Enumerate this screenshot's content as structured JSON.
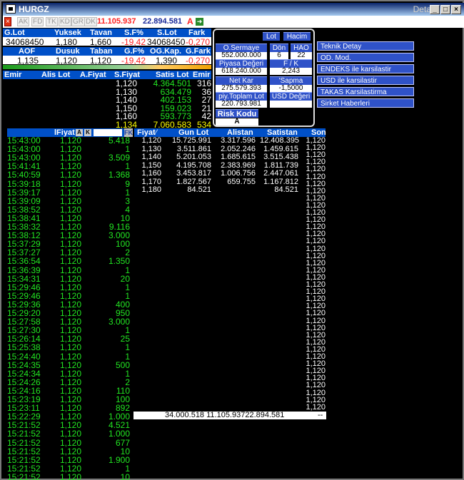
{
  "window": {
    "title": "HURGZ",
    "detail": "Detay",
    "min_icon": "minimize-icon",
    "max_icon": "maximize-icon",
    "close_icon": "close-icon"
  },
  "toolbar": {
    "buttons": [
      "AK",
      "FD",
      "TK",
      "KD",
      "GR",
      "DK"
    ],
    "value1": "11.105.937",
    "value2": "22.894.581",
    "a_label": "A"
  },
  "header1": {
    "labels": [
      "G.Lot",
      "Yuksek",
      "Tavan",
      "S.F%",
      "S.Lot",
      "Fark"
    ],
    "values": [
      "34068450",
      "1,180",
      "1,660",
      "-19,42",
      "34068450",
      "-0,270"
    ]
  },
  "header2": {
    "labels": [
      "AOF",
      "Dusuk",
      "Taban",
      "G.F%",
      "OG.Kap.",
      "G.Fark"
    ],
    "values": [
      "1,135",
      "1,120",
      "1,120",
      "-19,42",
      "1,390",
      "-0,270"
    ]
  },
  "panel": {
    "lot": "Lot",
    "hacim": "Hacim",
    "osermaye_label": "O.Sermaye",
    "osermaye": "552.000.000",
    "don_label": "Dön",
    "don": "6",
    "hao_label": "HAO",
    "hao": "22",
    "piyasa_label": "Piyasa Değeri",
    "piyasa": "618.240.000",
    "fk_label": "F / K",
    "fk": "2,243",
    "netkar_label": "Net Kar",
    "netkar": "275.579.393",
    "sapma_label": "'Sapma",
    "sapma": "-1,5000",
    "piy_label": "piy.Toplam Lot",
    "piy": "220.793.981",
    "usd_label": "USD Değeri",
    "usd": "",
    "risk_label": "Risk Kodu",
    "risk": "A"
  },
  "side_buttons": [
    "Teknik Detay",
    "OD. Mod.",
    "ENDEKS ile karsilastir",
    "USD ile karsilastir",
    "TAKAS Karsilastirma",
    "Sirket Haberleri"
  ],
  "depth": {
    "headers": [
      "Emir",
      "Alis Lot",
      "A.Fiyat",
      "S.Fiyat",
      "Satis Lot",
      "Emir"
    ],
    "rows": [
      [
        "1,120",
        "4.364.501",
        "316"
      ],
      [
        "1,130",
        "634.479",
        "36"
      ],
      [
        "1,140",
        "402.153",
        "27"
      ],
      [
        "1,150",
        "159.023",
        "21"
      ],
      [
        "1,160",
        "593.773",
        "42"
      ],
      [
        "1,134",
        "7.060.583",
        "534"
      ]
    ]
  },
  "trades": {
    "headers": [
      "lFiyat",
      "A",
      "K",
      "FK"
    ],
    "rows": [
      [
        "15:43:00",
        "1,120",
        "5.418"
      ],
      [
        "15:43:00",
        "1,120",
        "1"
      ],
      [
        "15:43:00",
        "1,120",
        "3.509"
      ],
      [
        "15:41:41",
        "1,120",
        "1"
      ],
      [
        "15:40:59",
        "1,120",
        "1.368"
      ],
      [
        "15:39:18",
        "1,120",
        "9"
      ],
      [
        "15:39:17",
        "1,120",
        "1"
      ],
      [
        "15:39:09",
        "1,120",
        "3"
      ],
      [
        "15:38:52",
        "1,120",
        "4"
      ],
      [
        "15:38:41",
        "1,120",
        "10"
      ],
      [
        "15:38:32",
        "1,120",
        "9.116"
      ],
      [
        "15:38:12",
        "1,120",
        "3.000"
      ],
      [
        "15:37:29",
        "1,120",
        "100"
      ],
      [
        "15:37:27",
        "1,120",
        "2"
      ],
      [
        "15:36:54",
        "1,120",
        "1.350"
      ],
      [
        "15:36:39",
        "1,120",
        "1"
      ],
      [
        "15:34:31",
        "1,120",
        "20"
      ],
      [
        "15:29:46",
        "1,120",
        "1"
      ],
      [
        "15:29:46",
        "1,120",
        "1"
      ],
      [
        "15:29:36",
        "1,120",
        "400"
      ],
      [
        "15:29:20",
        "1,120",
        "950"
      ],
      [
        "15:27:58",
        "1,120",
        "3.000"
      ],
      [
        "15:27:30",
        "1,120",
        "1"
      ],
      [
        "15:26:14",
        "1,120",
        "25"
      ],
      [
        "15:25:38",
        "1,120",
        "1"
      ],
      [
        "15:24:40",
        "1,120",
        "1"
      ],
      [
        "15:24:35",
        "1,120",
        "500"
      ],
      [
        "15:24:34",
        "1,120",
        "1"
      ],
      [
        "15:24:26",
        "1,120",
        "2"
      ],
      [
        "15:24:16",
        "1,120",
        "110"
      ],
      [
        "15:23:19",
        "1,120",
        "100"
      ],
      [
        "15:23:11",
        "1,120",
        "892"
      ],
      [
        "15:22:29",
        "1,120",
        "1.000"
      ],
      [
        "15:21:52",
        "1,120",
        "4.521"
      ],
      [
        "15:21:52",
        "1,120",
        "1.000"
      ],
      [
        "15:21:52",
        "1,120",
        "677"
      ],
      [
        "15:21:52",
        "1,120",
        "10"
      ],
      [
        "15:21:52",
        "1,120",
        "1.900"
      ],
      [
        "15:21:52",
        "1,120",
        "1"
      ],
      [
        "15:21:52",
        "1,120",
        "10"
      ]
    ]
  },
  "orderbook": {
    "headers": [
      "Fiyat",
      "Gun Lot",
      "Alistan",
      "Satistan",
      "Son"
    ],
    "rows": [
      [
        "1,120",
        "15.725.991",
        "3.317.596",
        "12.408.395"
      ],
      [
        "1,130",
        "3.511.861",
        "2.052.246",
        "1.459.615"
      ],
      [
        "1,140",
        "5.201.053",
        "1.685.615",
        "3.515.438"
      ],
      [
        "1,150",
        "4.195.708",
        "2.383.969",
        "1.811.739"
      ],
      [
        "1,160",
        "3.453.817",
        "1.006.756",
        "2.447.061"
      ],
      [
        "1,170",
        "1.827.567",
        "659.755",
        "1.167.812"
      ],
      [
        "1,180",
        "84.521",
        "",
        "84.521"
      ]
    ],
    "son": [
      "1,120",
      "1,120",
      "1,120",
      "1,120",
      "1,120",
      "1,120",
      "1,120",
      "1,120",
      "1,120",
      "1,120",
      "1,120",
      "1,120",
      "1,120",
      "1,120",
      "1,120",
      "1,120",
      "1,120",
      "1,120",
      "1,120",
      "1,120",
      "1,120",
      "1,120",
      "1,120",
      "1,120",
      "1,120",
      "1,120",
      "1,120",
      "1,120",
      "1,120",
      "1,120",
      "1,120",
      "1,120",
      "1,120",
      "1,120",
      "1,120",
      "1,120",
      "1,120",
      "1,120"
    ],
    "totals": "34.000.518 11.105.93722.894.581",
    "total_mark": "--"
  }
}
